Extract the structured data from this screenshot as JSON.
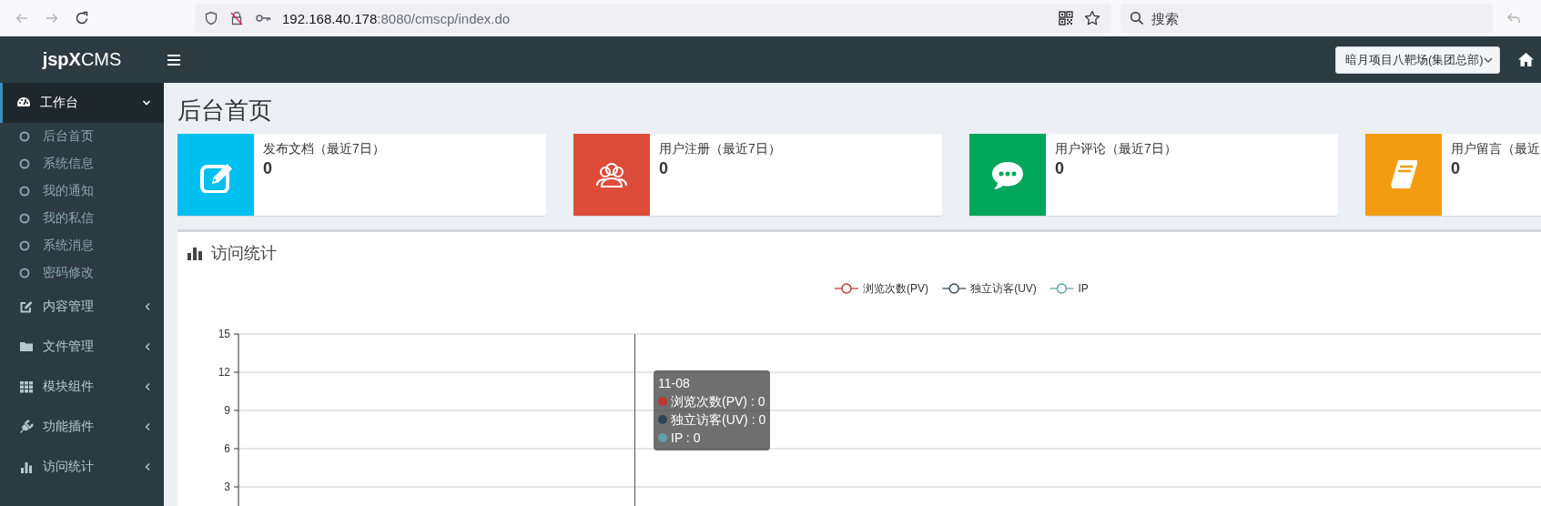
{
  "browser": {
    "url_host": "192.168.40.178",
    "url_path": ":8080/cmscp/index.do",
    "search": {
      "placeholder": "搜索"
    }
  },
  "navbar": {
    "logo": "**jspX**CMS",
    "site_select": "暗月项目八靶场(集团总部)"
  },
  "sidebar": {
    "items": [
      {
        "label": "工作台",
        "kind": "dashboard",
        "expanded": true,
        "selected": true,
        "children": [
          {
            "label": "后台首页"
          },
          {
            "label": "系统信息"
          },
          {
            "label": "我的通知"
          },
          {
            "label": "我的私信"
          },
          {
            "label": "系统消息"
          },
          {
            "label": "密码修改"
          }
        ]
      },
      {
        "label": "内容管理",
        "kind": "edit",
        "expanded": false,
        "selected": false
      },
      {
        "label": "文件管理",
        "kind": "folder",
        "expanded": false,
        "selected": false
      },
      {
        "label": "模块组件",
        "kind": "grid",
        "expanded": false,
        "selected": false
      },
      {
        "label": "功能插件",
        "kind": "plug",
        "expanded": false,
        "selected": false
      },
      {
        "label": "访问统计",
        "kind": "chart",
        "expanded": false,
        "selected": false
      }
    ]
  },
  "page_title": "后台首页",
  "stat_cards": [
    {
      "label": "发布文档（最近7日）",
      "value": "0",
      "kind": "edit",
      "color": "#00c0ef"
    },
    {
      "label": "用户注册（最近7日）",
      "value": "0",
      "kind": "users",
      "color": "#dd4b39"
    },
    {
      "label": "用户评论（最近7日）",
      "value": "0",
      "kind": "comment",
      "color": "#00a65a"
    },
    {
      "label": "用户留言（最近",
      "value": "0",
      "kind": "book",
      "color": "#f39c12"
    }
  ],
  "visits": {
    "title": "访问统计",
    "chart_data": {
      "type": "line",
      "ylim": [
        1.5,
        15
      ],
      "yticks": [
        3,
        6,
        9,
        12,
        15
      ],
      "grid": true,
      "series": [
        {
          "name": "浏览次数(PV)",
          "color": "#c23531"
        },
        {
          "name": "独立访客(UV)",
          "color": "#2f4554"
        },
        {
          "name": "IP",
          "color": "#61a0a8"
        }
      ]
    },
    "tooltip": {
      "title": "11-08",
      "rows": [
        "浏览次数(PV) : 0",
        "独立访客(UV) : 0",
        "IP : 0"
      ]
    }
  }
}
